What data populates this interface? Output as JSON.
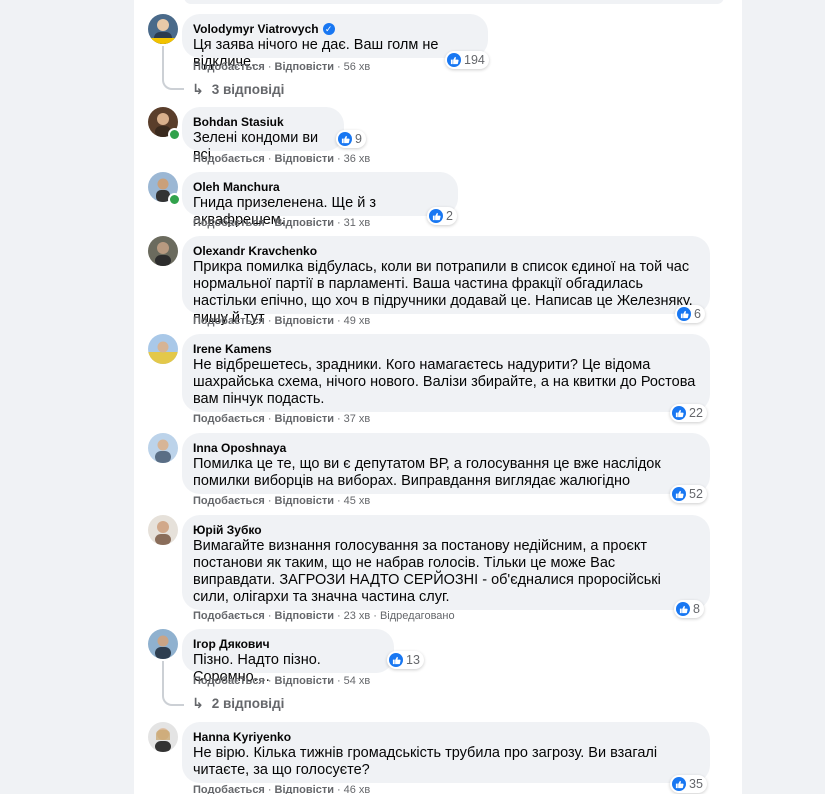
{
  "action_like": "Подобається",
  "action_reply": "Відповісти",
  "comments": [
    {
      "author": "Volodymyr Viatrovych",
      "verified": true,
      "text": "Ця заява нічого не дає. Ваш голм не відкличе.",
      "likes": "194",
      "time": "56 хв",
      "replies": "3 відповіді"
    },
    {
      "author": "Bohdan Stasiuk",
      "text": "Зелені кондоми ви всі.",
      "likes": "9",
      "time": "36 хв"
    },
    {
      "author": "Oleh Manchura",
      "text": "Гнида призеленена. Ще й з аквафрешем.",
      "likes": "2",
      "time": "31 хв"
    },
    {
      "author": "Olexandr Kravchenko",
      "text": "Прикра помилка відбулась, коли ви потрапили в список єдиної на той час нормальної партії в парламенті. Ваша частина фракції обгадилась настільки епічно, що хоч в підручники додавай це. Написав це Железняку, пишу й тут",
      "likes": "6",
      "time": "49 хв"
    },
    {
      "author": "Irene Kamens",
      "text": "Не відбрешетесь, зрадники. Кого намагаєтесь надурити? Це відома шахрайська схема, нічого нового. Валізи збирайте, а на квитки до Ростова вам пінчук подасть.",
      "likes": "22",
      "time": "37 хв"
    },
    {
      "author": "Inna Oposhnaya",
      "text": "Помилка це те, що ви є депутатом ВР, а голосування це вже наслідок помилки виборців на виборах. Виправдання виглядає жалюгідно",
      "likes": "52",
      "time": "45 хв"
    },
    {
      "author": "Юрій Зубко",
      "text": "Вимагайте визнання голосування за постанову недійсним, а проєкт постанови як таким, що не набрав голосів. Тільки це може Вас виправдати. ЗАГРОЗИ НАДТО СЕРЙОЗНІ - об'єдналися проросійські сили, олігархи та значна частина слуг.",
      "likes": "8",
      "time": "23 хв",
      "edited": "Відредаговано"
    },
    {
      "author": "Ігор Дякович",
      "text": "Пізно. Надто пізно. Соромно....",
      "likes": "13",
      "time": "54 хв",
      "replies": "2 відповіді"
    },
    {
      "author": "Hanna Kyriyenko",
      "text": "Не вірю. Кілька тижнів громадськість трубила про загрозу. Ви взагалі читаєте, за що голосуєте?",
      "likes": "35",
      "time": "46 хв"
    }
  ]
}
